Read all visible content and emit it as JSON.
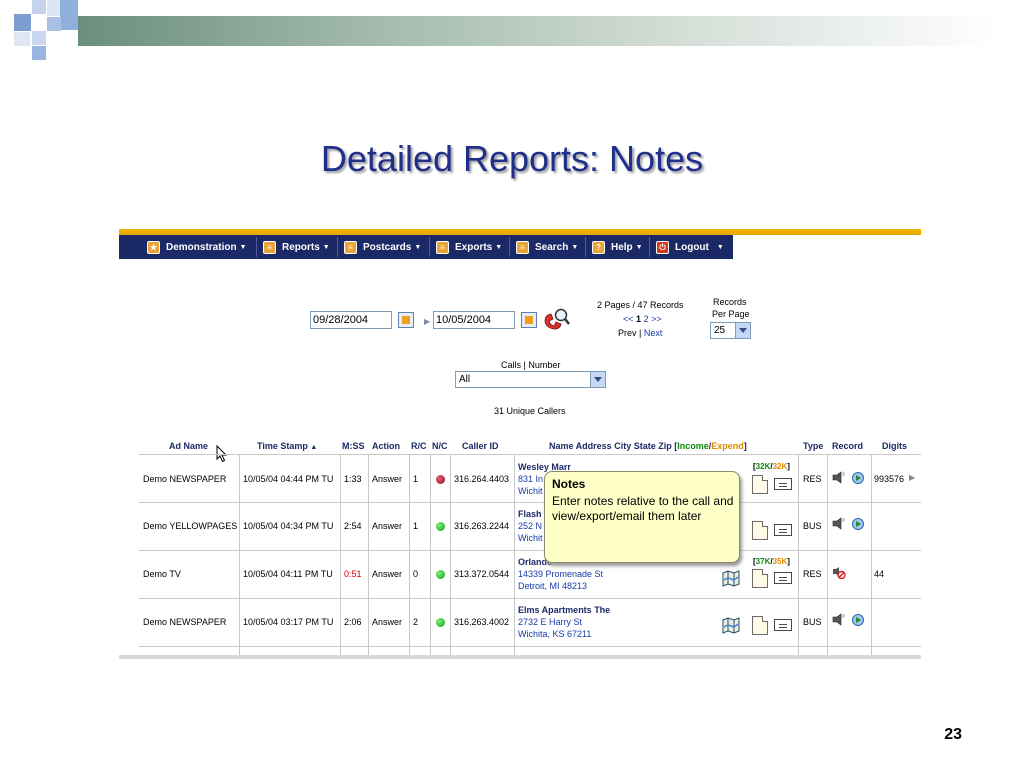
{
  "slide": {
    "title": "Detailed Reports:  Notes",
    "number": "23"
  },
  "nav": {
    "items": [
      {
        "label": "Demonstration"
      },
      {
        "label": "Reports"
      },
      {
        "label": "Postcards"
      },
      {
        "label": "Exports"
      },
      {
        "label": "Search"
      },
      {
        "label": "Help"
      },
      {
        "label": "Logout"
      }
    ]
  },
  "filters": {
    "date_from": "09/28/2004",
    "date_to": "10/05/2004",
    "pagination": {
      "summary": "2 Pages / 47 Records",
      "prev_arrows": "<<",
      "current_page": "1",
      "other_page": "2",
      "next_arrows": ">>",
      "prev_label": "Prev",
      "separator": "|",
      "next_label": "Next"
    },
    "records_per_page_label_1": "Records",
    "records_per_page_label_2": "Per Page",
    "records_per_page_value": "25",
    "calls_label": "Calls | Number",
    "calls_value": "All",
    "unique_callers": "31 Unique Callers"
  },
  "table": {
    "headers": {
      "ad_name": "Ad Name",
      "time_stamp": "Time Stamp",
      "mss": "M:SS",
      "action": "Action",
      "rc": "R/C",
      "nc": "N/C",
      "caller_id": "Caller ID",
      "name_address": "Name Address City State Zip [",
      "income": "Income",
      "slash": "/",
      "expend": "Expend",
      "close_bracket": "]",
      "type": "Type",
      "record": "Record",
      "digits": "Digits"
    },
    "rows": [
      {
        "ad_name": "Demo NEWSPAPER",
        "time_stamp": "10/05/04 04:44 PM TU",
        "mss": "1:33",
        "action": "Answer",
        "rc": "1",
        "status": "red",
        "caller_id": "316.264.4403",
        "name": "Wesley Marr",
        "addr1": "831 In",
        "addr2": "Wichit",
        "k_income": "32K",
        "k_expend": "32K",
        "type": "RES",
        "digits": "993576"
      },
      {
        "ad_name": "Demo YELLOWPAGES",
        "time_stamp": "10/05/04 04:34 PM TU",
        "mss": "2:54",
        "action": "Answer",
        "rc": "1",
        "status": "green",
        "caller_id": "316.263.2244",
        "name": "Flash",
        "addr1": "252 N",
        "addr2": "Wichit",
        "type": "BUS",
        "digits": ""
      },
      {
        "ad_name": "Demo TV",
        "time_stamp": "10/05/04 04:11 PM TU",
        "mss": "0:51",
        "action": "Answer",
        "rc": "0",
        "status": "green",
        "caller_id": "313.372.0544",
        "name": "Orlando",
        "addr1": "14339 Promenade St",
        "addr2": "Detroit, MI 48213",
        "k_income": "37K",
        "k_expend": "35K",
        "type": "RES",
        "digits": "44"
      },
      {
        "ad_name": "Demo NEWSPAPER",
        "time_stamp": "10/05/04 03:17 PM TU",
        "mss": "2:06",
        "action": "Answer",
        "rc": "2",
        "status": "green",
        "caller_id": "316.263.4002",
        "name": "Elms Apartments The",
        "addr1": "2732 E Harry St",
        "addr2": "Wichita, KS 67211",
        "type": "BUS",
        "digits": ""
      }
    ]
  },
  "tooltip": {
    "title": "Notes",
    "body": "Enter notes relative to the call and view/export/email them later"
  },
  "colors": {
    "nav_bg": "#1b2a66",
    "title": "#1f2f8a",
    "income": "#0a8a0a",
    "expend": "#e08a00",
    "tooltip_bg": "#ffffc8"
  }
}
